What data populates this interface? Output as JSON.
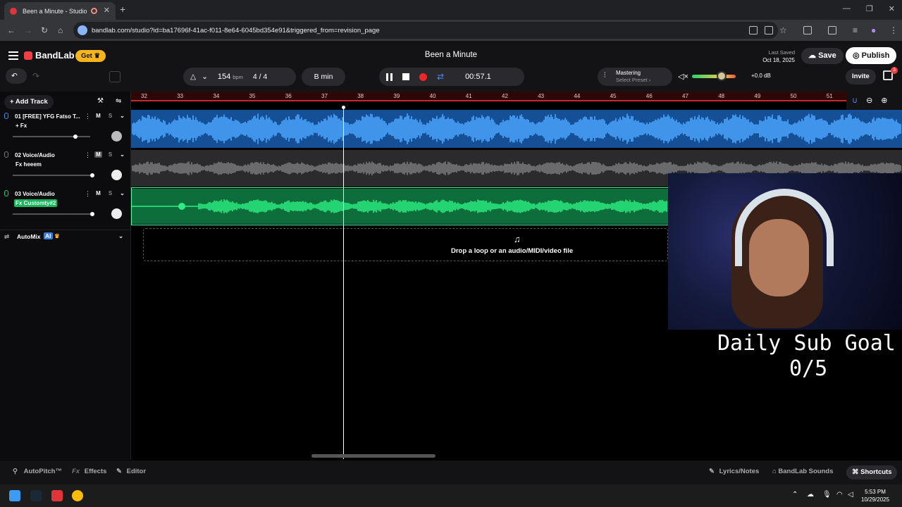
{
  "browser": {
    "tab_title": "Been a Minute - Studio",
    "url": "bandlab.com/studio?id=ba17696f-41ac-f011-8e64-6045bd354e91&triggered_from=revision_page"
  },
  "header": {
    "brand": "BandLab",
    "get_label": "Get",
    "song_title": "Been a Minute",
    "last_saved_label": "Last Saved",
    "last_saved_date": "Oct 18, 2025",
    "save_label": "Save",
    "publish_label": "Publish",
    "invite_label": "Invite",
    "gift_badge": "3"
  },
  "toolbar": {
    "bpm": "154",
    "bpm_unit": "bpm",
    "time_sig": "4 / 4",
    "key": "B min",
    "time": "00:57.1",
    "mastering_label": "Mastering",
    "mastering_preset": "Select Preset",
    "volume_db": "+0.0 dB"
  },
  "ruler": {
    "ticks": [
      "32",
      "33",
      "34",
      "35",
      "36",
      "37",
      "38",
      "39",
      "40",
      "41",
      "42",
      "43",
      "44",
      "45",
      "46",
      "47",
      "48",
      "49",
      "50",
      "51"
    ]
  },
  "tracks": [
    {
      "num": "01  [FREE] YFG Fatso T...",
      "fx": "+ Fx",
      "color": "#3a8ef6"
    },
    {
      "num": "02  Voice/Audio",
      "fx": "Fx heeem",
      "color": "#7a7a7c"
    },
    {
      "num": "03  Voice/Audio",
      "fx": "Fx Customty#2",
      "color": "#22d36b"
    }
  ],
  "left_panel": {
    "add_track": "Add Track",
    "mute": "M",
    "solo": "S",
    "automix": "AutoMix",
    "ai_badge": "AI"
  },
  "canvas": {
    "drop_text": "Drop a loop or an audio/MIDI/video file"
  },
  "overlay": {
    "goal_line1": "Daily Sub Goal",
    "goal_line2": "0/5"
  },
  "bottom": {
    "autopitch": "AutoPitch™",
    "effects": "Effects",
    "editor": "Editor",
    "lyrics": "Lyrics/Notes",
    "sounds": "BandLab Sounds",
    "shortcuts": "Shortcuts"
  },
  "taskbar": {
    "time": "5:53 PM",
    "date": "10/29/2025"
  }
}
